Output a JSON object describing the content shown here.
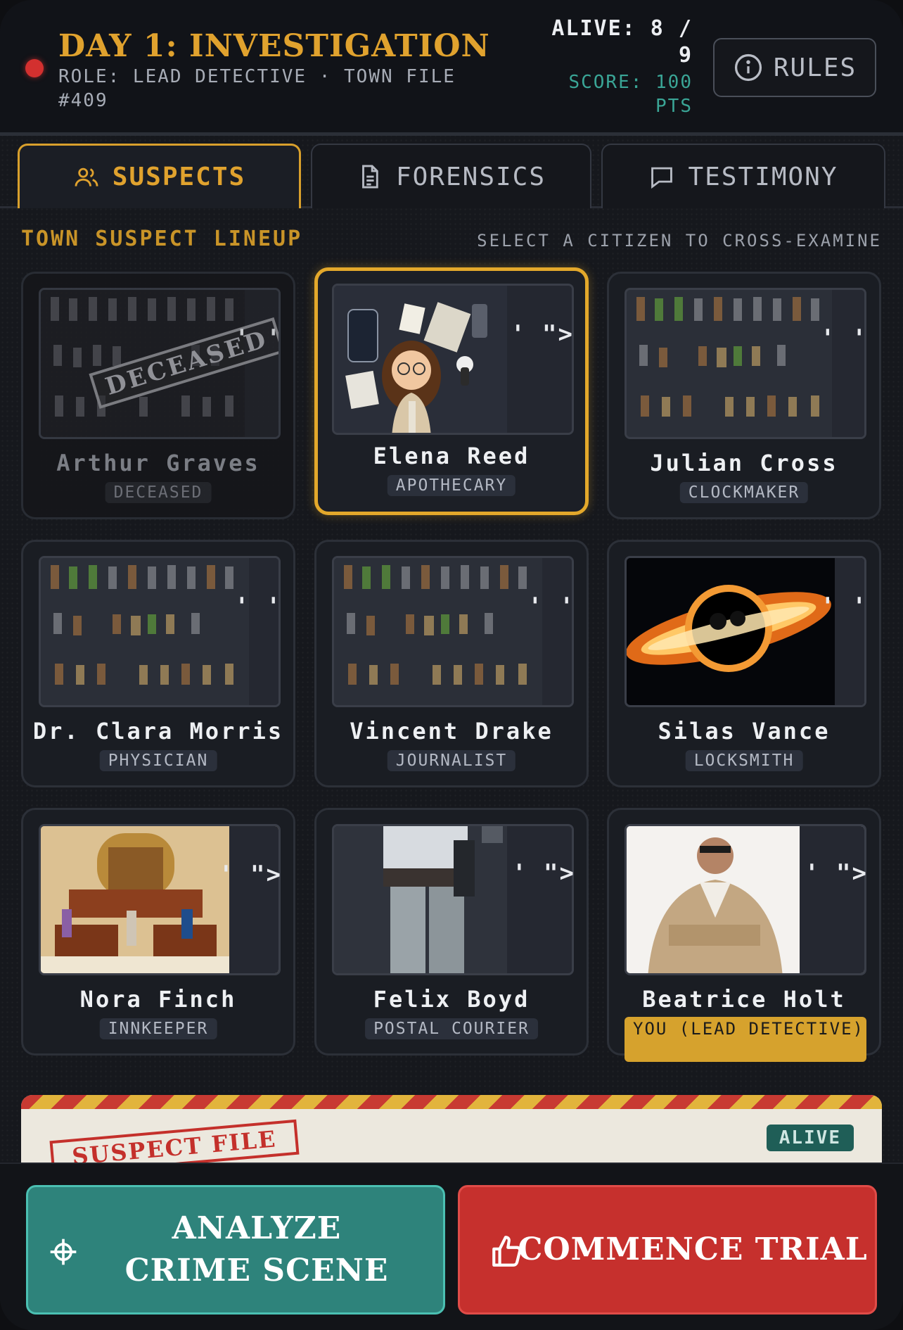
{
  "header": {
    "day_title": "DAY 1: INVESTIGATION",
    "role_line": "ROLE: LEAD DETECTIVE · TOWN FILE #409",
    "alive": "ALIVE: 8 / 9",
    "score": "SCORE: 100 PTS",
    "rules_label": "RULES"
  },
  "tabs": [
    {
      "label": "SUSPECTS",
      "icon": "users-icon",
      "active": true
    },
    {
      "label": "FORENSICS",
      "icon": "document-icon",
      "active": false
    },
    {
      "label": "TESTIMONY",
      "icon": "chat-icon",
      "active": false
    }
  ],
  "lineup": {
    "title": "TOWN SUSPECT LINEUP",
    "hint": "SELECT A CITIZEN TO CROSS-EXAMINE"
  },
  "suspects": [
    {
      "name": "Arthur Graves",
      "role": "DECEASED",
      "quote": "' '",
      "stamp": "DECEASED",
      "portrait": "pixel-villagers"
    },
    {
      "name": "Elena Reed",
      "role": "APOTHECARY",
      "quote": "' \">",
      "portrait": "cartoon-reporter"
    },
    {
      "name": "Julian Cross",
      "role": "CLOCKMAKER",
      "quote": "' '",
      "portrait": "pixel-villagers"
    },
    {
      "name": "Dr. Clara Morris",
      "role": "PHYSICIAN",
      "quote": "' '",
      "portrait": "pixel-villagers"
    },
    {
      "name": "Vincent Drake",
      "role": "JOURNALIST",
      "quote": "' '",
      "portrait": "pixel-villagers"
    },
    {
      "name": "Silas Vance",
      "role": "LOCKSMITH",
      "quote": "' '",
      "portrait": "black-hole"
    },
    {
      "name": "Nora Finch",
      "role": "INNKEEPER",
      "quote": "' \">",
      "portrait": "courtroom"
    },
    {
      "name": "Felix Boyd",
      "role": "POSTAL COURIER",
      "quote": "' \">",
      "portrait": "figure-legs"
    },
    {
      "name": "Beatrice Holt",
      "role": "YOU (LEAD DETECTIVE)",
      "quote": "' \">",
      "portrait": "trenchcoat-man"
    }
  ],
  "suspect_file": {
    "stamp": "SUSPECT FILE",
    "status": "ALIVE"
  },
  "actions": {
    "analyze": "ANALYZE CRIME SCENE",
    "trial": "COMMENCE TRIAL"
  },
  "colors": {
    "accent_gold": "#e0a22e",
    "teal": "#2e837b",
    "danger_red": "#c6302d"
  }
}
